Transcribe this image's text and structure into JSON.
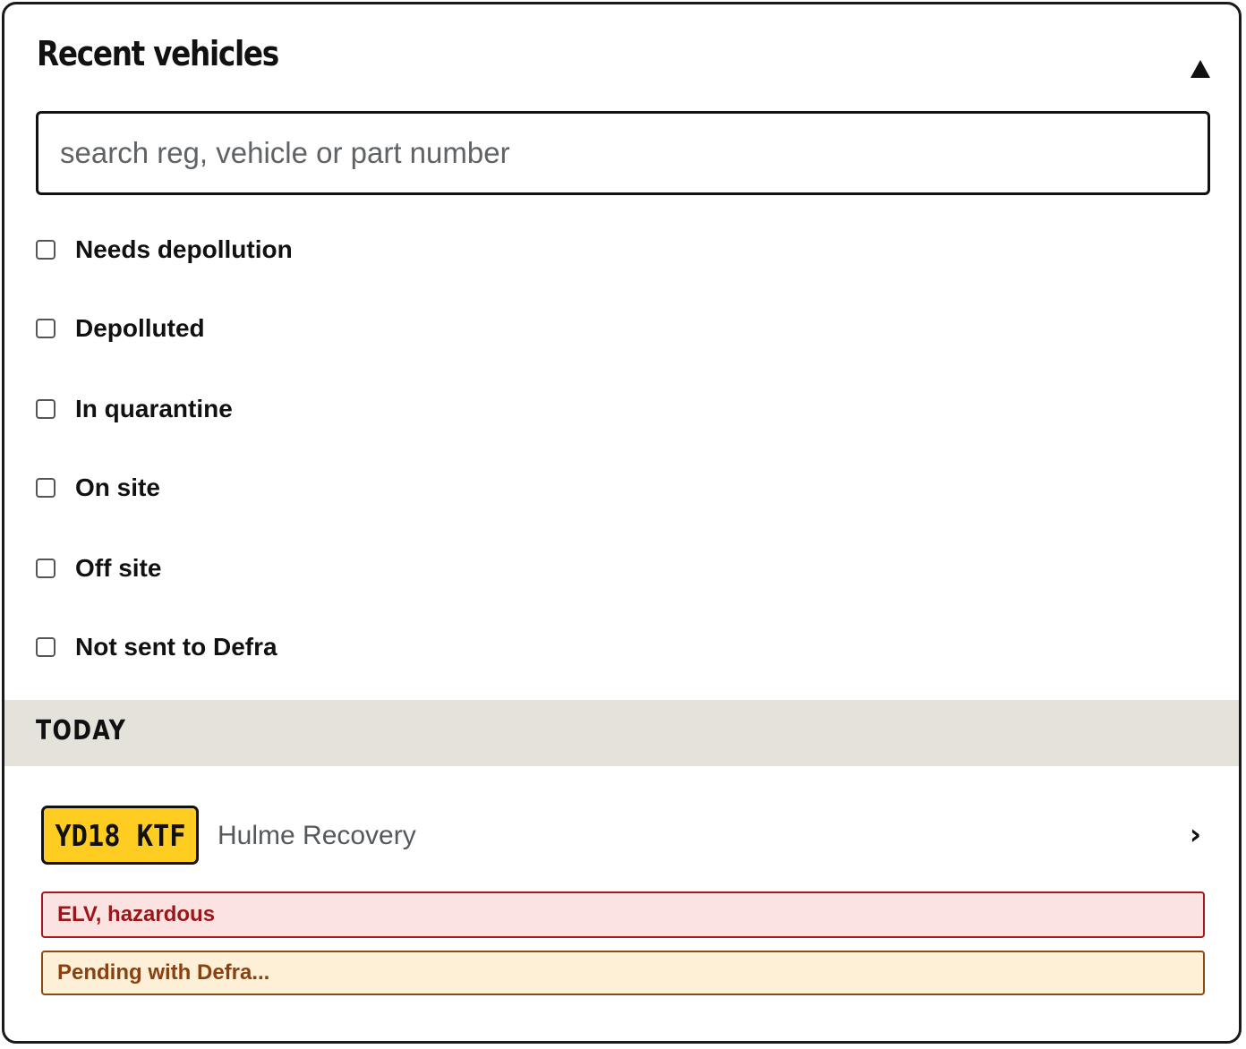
{
  "panel": {
    "title": "Recent vehicles",
    "collapse_icon": "triangle-up-icon"
  },
  "search": {
    "placeholder": "search reg, vehicle or part number",
    "value": ""
  },
  "filters": [
    {
      "label": "Needs depollution",
      "checked": false
    },
    {
      "label": "Depolluted",
      "checked": false
    },
    {
      "label": "In quarantine",
      "checked": false
    },
    {
      "label": "On site",
      "checked": false
    },
    {
      "label": "Off site",
      "checked": false
    },
    {
      "label": "Not sent to Defra",
      "checked": false
    }
  ],
  "sections": [
    {
      "label": "TODAY",
      "vehicles": [
        {
          "reg": "YD18 KTF",
          "name": "Hulme Recovery",
          "chevron": "›",
          "tags": [
            {
              "label": "ELV, hazardous",
              "kind": "danger"
            },
            {
              "label": "Pending with Defra...",
              "kind": "warning"
            }
          ]
        }
      ]
    }
  ],
  "colors": {
    "plate_yellow": "#ffcc22",
    "section_bg": "#e5e2db",
    "danger_text": "#9c1519",
    "danger_bg": "#fae3e1",
    "warning_text": "#8a400f",
    "warning_bg": "#fef0d7"
  }
}
